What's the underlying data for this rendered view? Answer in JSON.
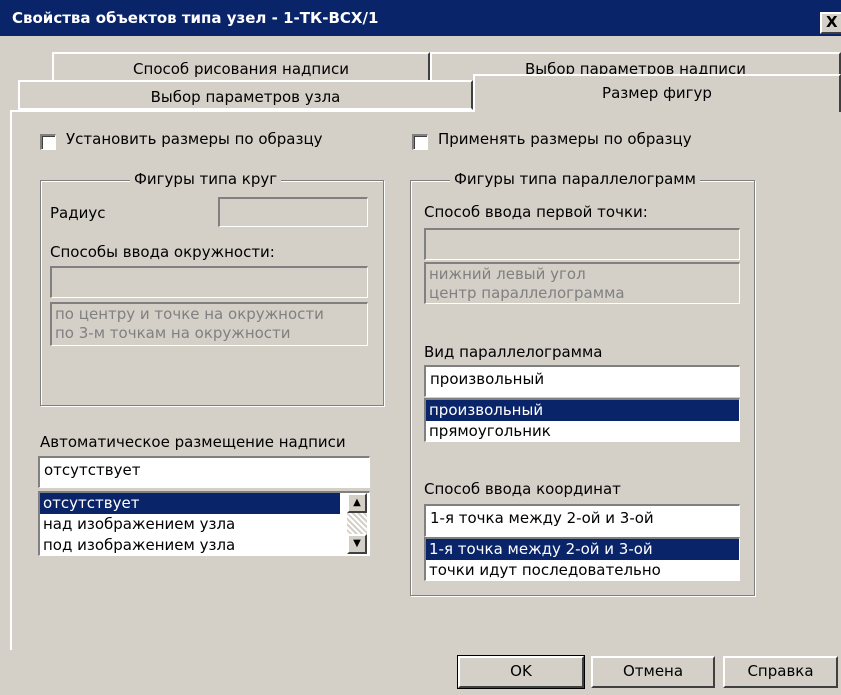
{
  "window": {
    "title": "Свойства объектов типа узел - 1-ТК-ВСХ/1",
    "close_label": "X"
  },
  "tabs": {
    "row1": [
      "Способ рисования надписи",
      "Выбор параметров надписи"
    ],
    "row2": [
      "Выбор параметров узла",
      "Размер фигур"
    ],
    "active": "Размер фигур"
  },
  "left": {
    "checkbox_label": "Установить размеры по образцу",
    "group_title": "Фигуры типа круг",
    "radius_label": "Радиус",
    "radius_value": "",
    "circle_input_label": "Способы ввода окружности:",
    "circle_input_value": "",
    "circle_options": [
      "по центру и точке на окружности",
      "по 3-м точкам на окружности"
    ],
    "auto_label_title": "Автоматическое размещение надписи",
    "auto_label_value": "отсутствует",
    "auto_label_options": [
      "отсутствует",
      "над изображением узла",
      "под изображением узла"
    ],
    "auto_label_selected": "отсутствует"
  },
  "right": {
    "checkbox_label": "Применять размеры по образцу",
    "group_title": "Фигуры типа параллелограмм",
    "first_point_label": "Способ ввода первой точки:",
    "first_point_value": "",
    "first_point_options": [
      "нижний левый угол",
      "центр параллелограмма"
    ],
    "view_label": "Вид параллелограмма",
    "view_value": "произвольный",
    "view_options": [
      "произвольный",
      "прямоугольник"
    ],
    "view_selected": "произвольный",
    "coord_label": "Способ ввода координат",
    "coord_value": "1-я точка между 2-ой и 3-ой",
    "coord_options": [
      "1-я точка между 2-ой и 3-ой",
      "точки идут последовательно"
    ],
    "coord_selected": "1-я точка между 2-ой и 3-ой"
  },
  "buttons": {
    "ok": "OK",
    "cancel": "Отмена",
    "help": "Справка"
  },
  "colors": {
    "titlebar": "#0a246a",
    "selection": "#0a246a",
    "face": "#d4d0c8"
  },
  "icons": {
    "scroll_up": "▲",
    "scroll_down": "▼"
  }
}
